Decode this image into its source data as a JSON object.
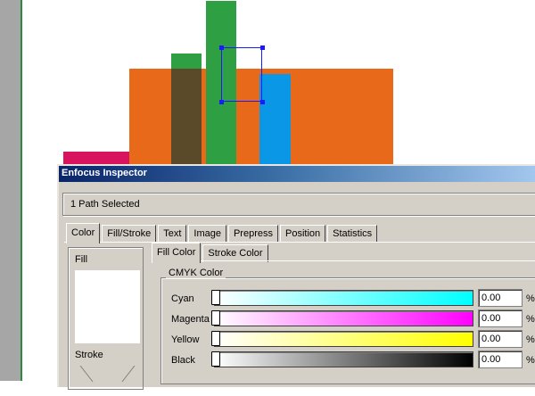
{
  "window": {
    "title": "Enfocus Inspector"
  },
  "status": "1 Path Selected",
  "tabs": [
    {
      "label": "Color",
      "active": true
    },
    {
      "label": "Fill/Stroke",
      "active": false
    },
    {
      "label": "Text",
      "active": false
    },
    {
      "label": "Image",
      "active": false
    },
    {
      "label": "Prepress",
      "active": false
    },
    {
      "label": "Position",
      "active": false
    },
    {
      "label": "Statistics",
      "active": false
    }
  ],
  "swatches": {
    "fill_label": "Fill",
    "stroke_label": "Stroke"
  },
  "subtabs": [
    {
      "label": "Fill Color",
      "active": true
    },
    {
      "label": "Stroke Color",
      "active": false
    }
  ],
  "cmyk": {
    "title": "CMYK Color",
    "rows": [
      {
        "label": "Cyan",
        "value": "0.00",
        "unit": "%",
        "gradient": [
          "#ffffff",
          "#00ffff"
        ]
      },
      {
        "label": "Magenta",
        "value": "0.00",
        "unit": "%",
        "gradient": [
          "#ffffff",
          "#ff00ff"
        ]
      },
      {
        "label": "Yellow",
        "value": "0.00",
        "unit": "%",
        "gradient": [
          "#ffffff",
          "#ffff00"
        ]
      },
      {
        "label": "Black",
        "value": "0.00",
        "unit": "%",
        "gradient": [
          "#ffffff",
          "#000000"
        ]
      }
    ]
  },
  "colors": {
    "orange": "#e8691a",
    "green": "#2ea043",
    "dark_olive": "#5b4a2a",
    "blue": "#0a97e6",
    "magenta": "#d8145e"
  }
}
